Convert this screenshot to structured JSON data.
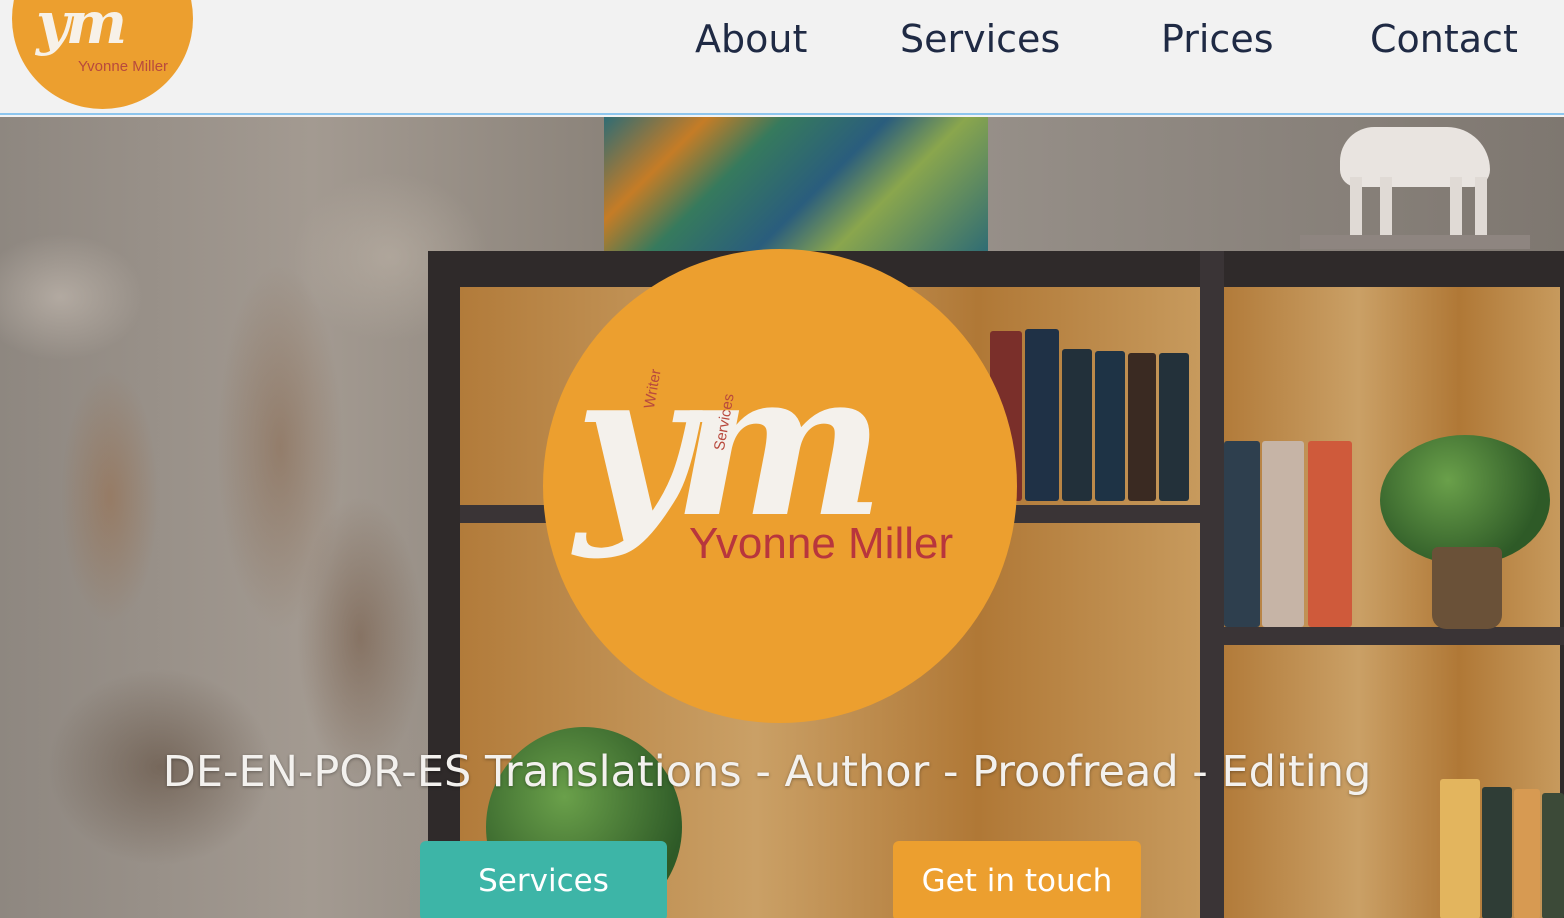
{
  "header": {
    "logo": {
      "monogram": "ym",
      "name": "Yvonne Miller"
    },
    "nav": [
      {
        "label": "About"
      },
      {
        "label": "Services"
      },
      {
        "label": "Prices"
      },
      {
        "label": "Contact"
      }
    ]
  },
  "hero": {
    "logo": {
      "monogram": "ym",
      "tag_writer": "Writer",
      "tag_services": "Services",
      "name": "Yvonne Miller"
    },
    "tagline": "DE-EN-POR-ES Translations - Author - Proofread - Editing",
    "buttons": {
      "services": "Services",
      "contact": "Get in touch"
    }
  },
  "colors": {
    "brand_orange": "#ec9f2f",
    "brand_teal": "#3db5a7",
    "brand_red": "#b8363d",
    "nav_text": "#1f2a44"
  }
}
